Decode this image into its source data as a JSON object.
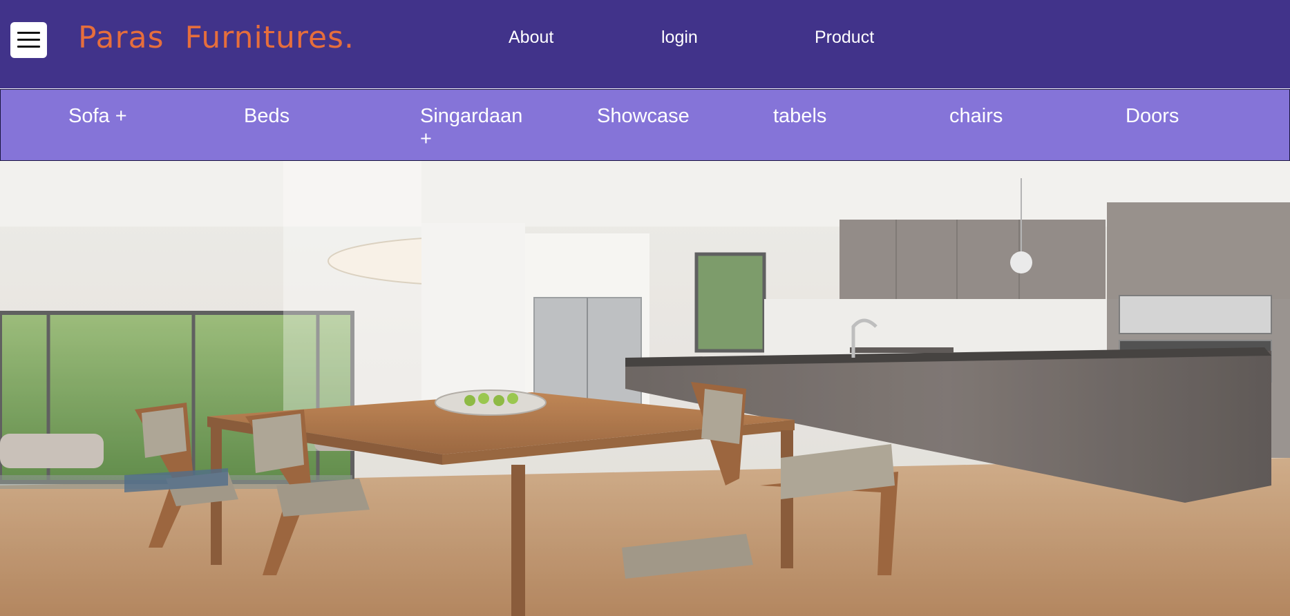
{
  "header": {
    "brand_word1": "Paras",
    "brand_word2": "Furnitures.",
    "nav": [
      {
        "label": "About"
      },
      {
        "label": "login"
      },
      {
        "label": "Product"
      }
    ]
  },
  "categories": [
    {
      "label": "Sofa +"
    },
    {
      "label": "Beds"
    },
    {
      "label": "Singardaan +"
    },
    {
      "label": "Showcase"
    },
    {
      "label": "tabels"
    },
    {
      "label": "chairs"
    },
    {
      "label": "Doors"
    }
  ],
  "icons": {
    "menu": "hamburger-menu-icon"
  },
  "colors": {
    "topbar": "#41338a",
    "category_bar": "#8574d8",
    "brand": "#e66e3c",
    "nav_text": "#ffffff"
  }
}
